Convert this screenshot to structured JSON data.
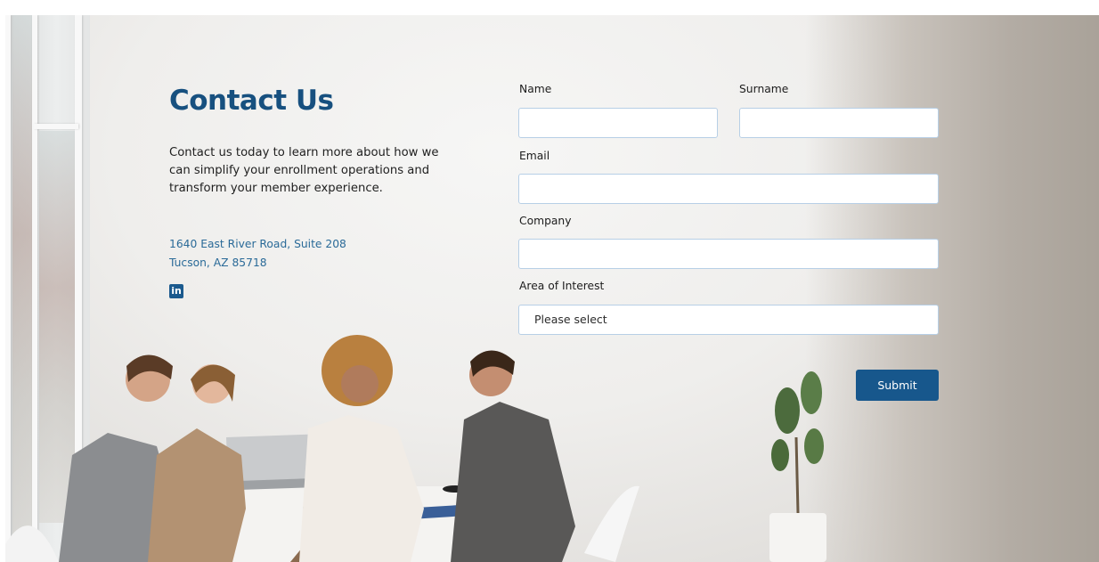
{
  "contact": {
    "title": "Contact Us",
    "intro": "Contact us today to learn more about how we can simplify your enrollment operations and transform your member experience.",
    "address_line1": "1640 East River Road, Suite 208",
    "address_line2": "Tucson, AZ 85718",
    "social_icon": "linkedin-icon",
    "social_glyph": "in"
  },
  "form": {
    "name_label": "Name",
    "name_value": "",
    "surname_label": "Surname",
    "surname_value": "",
    "email_label": "Email",
    "email_value": "",
    "company_label": "Company",
    "company_value": "",
    "interest_label": "Area of Interest",
    "interest_selected": "Please select",
    "submit_label": "Submit"
  },
  "colors": {
    "brand_blue": "#17578c",
    "heading_blue": "#17507f",
    "link_blue": "#2a6a98",
    "field_border": "#b7cfe6"
  }
}
